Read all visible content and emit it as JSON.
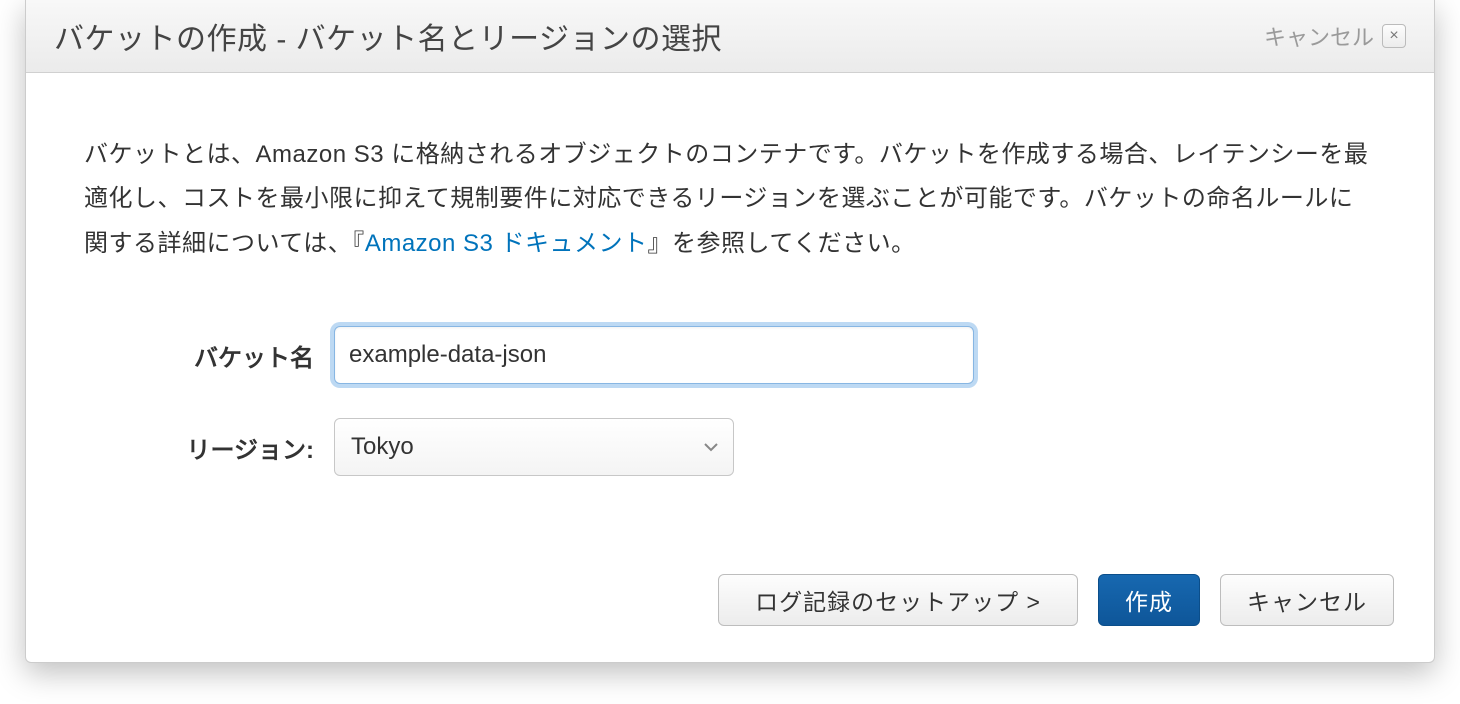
{
  "header": {
    "title": "バケットの作成 - バケット名とリージョンの選択",
    "cancel_text": "キャンセル",
    "close_glyph": "×"
  },
  "body": {
    "description_pre": "バケットとは、Amazon S3 に格納されるオブジェクトのコンテナです。バケットを作成する場合、レイテンシーを最適化し、コストを最小限に抑えて規制要件に対応できるリージョンを選ぶことが可能です。バケットの命名ルールに関する詳細については、『",
    "description_link": "Amazon S3 ドキュメント",
    "description_post": "』を参照してください。"
  },
  "form": {
    "bucket_name_label": "バケット名",
    "bucket_name_value": "example-data-json",
    "region_label": "リージョン:",
    "region_value": "Tokyo"
  },
  "footer": {
    "setup_logging": "ログ記録のセットアップ >",
    "create": "作成",
    "cancel": "キャンセル"
  }
}
